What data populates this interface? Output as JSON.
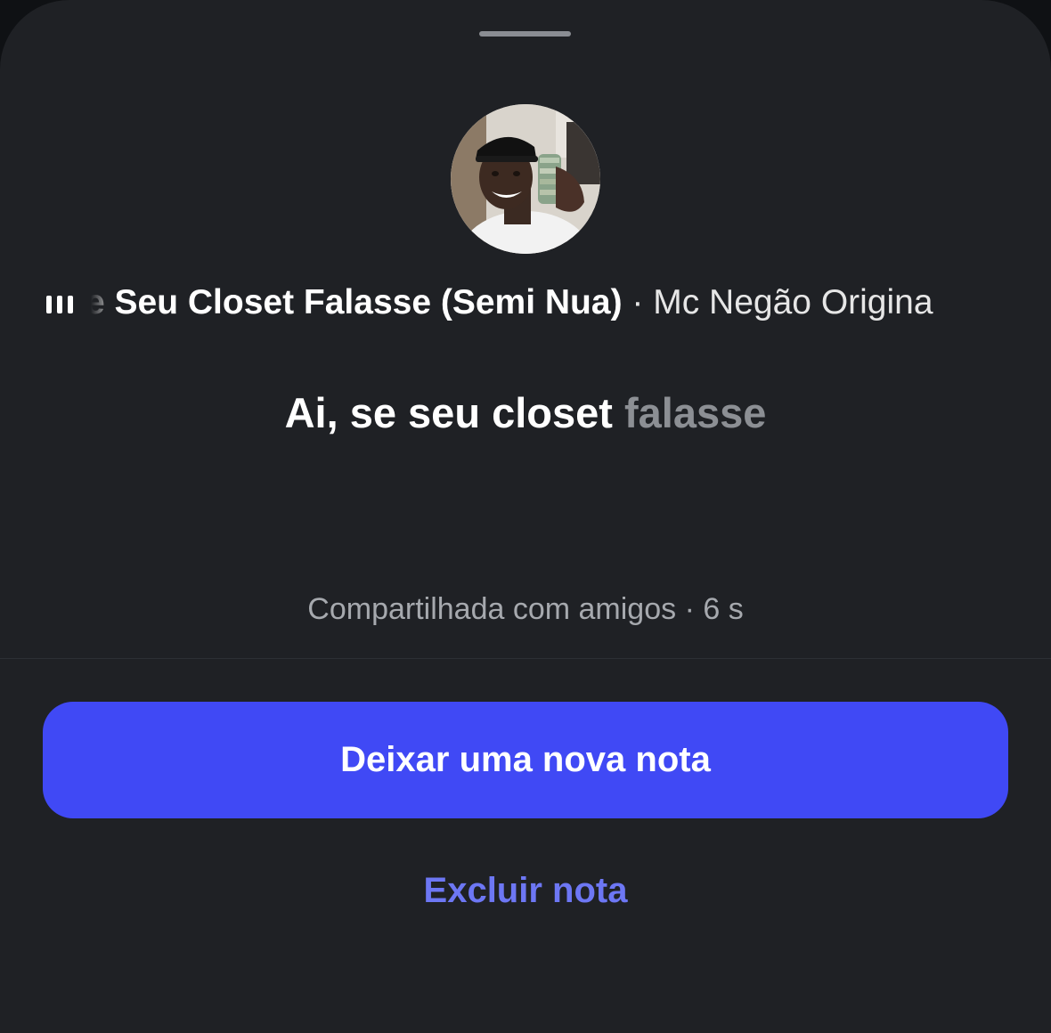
{
  "note_sheet": {
    "song": {
      "title_fragment": "e Seu Closet Falasse (Semi Nua)",
      "separator": " · ",
      "artist_fragment": "Mc Negão Origina"
    },
    "note": {
      "sung": "Ai, se seu closet ",
      "pending": "falasse"
    },
    "shared_with": "Compartilhada com amigos · 6 s",
    "actions": {
      "primary_label": "Deixar uma nova nota",
      "delete_label": "Excluir nota"
    },
    "colors": {
      "sheet_background": "#1f2125",
      "primary_button": "#4049f5",
      "delete_link": "#6d77f4",
      "pending_lyric": "#8c8f94",
      "secondary_text": "#a6a9ae"
    },
    "icons": {
      "music_indicator": "audio-bars-icon",
      "avatar": "profile-photo"
    }
  }
}
